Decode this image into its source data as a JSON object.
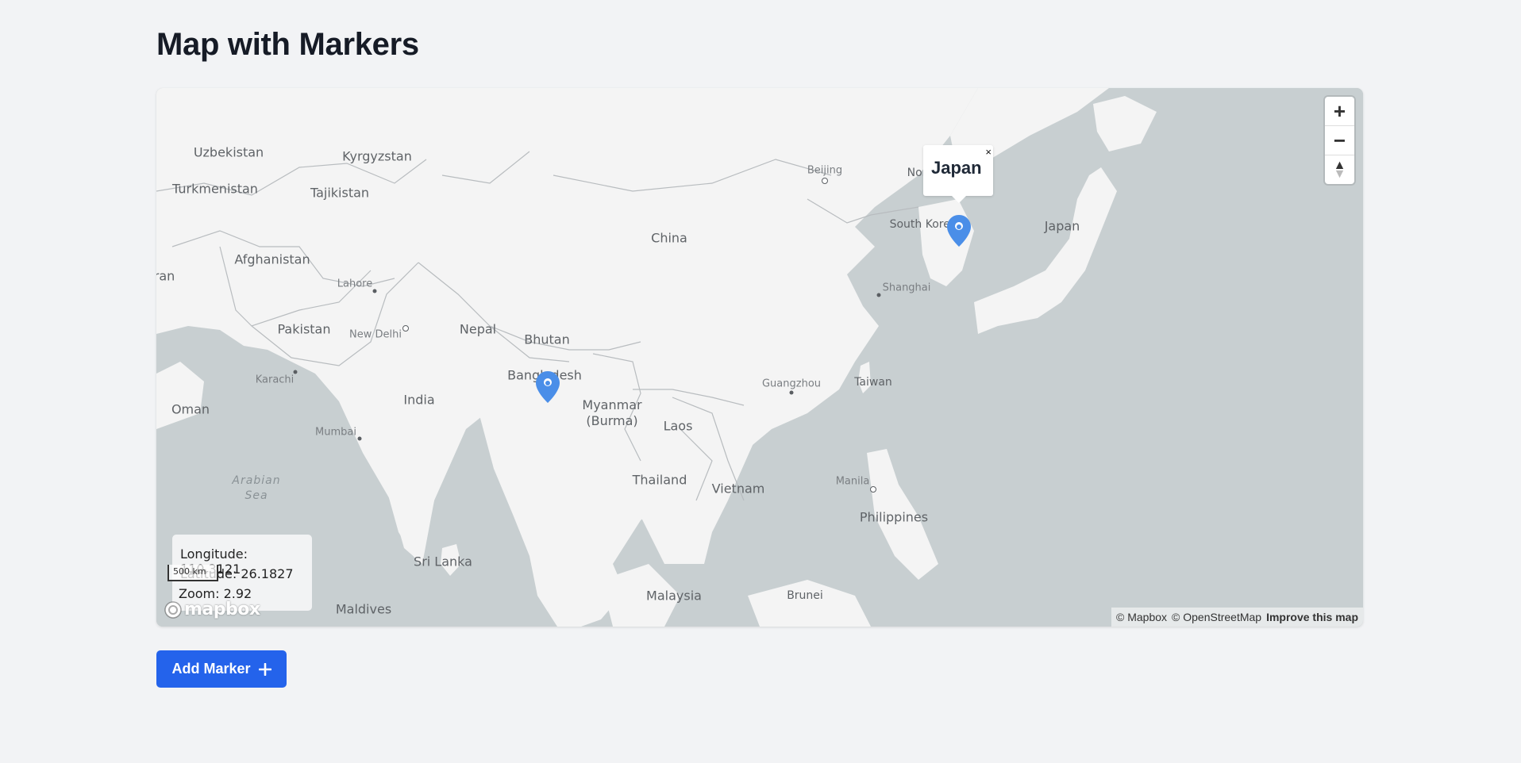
{
  "page": {
    "title": "Map with Markers"
  },
  "map": {
    "colors": {
      "water": "#c8cfd1",
      "land": "#f4f4f4",
      "border": "#b8bcbf",
      "marker": "#4a8ee8"
    },
    "countries": [
      "Uzbekistan",
      "Kyrgyzstan",
      "Turkmenistan",
      "Tajikistan",
      "Afghanistan",
      "ran",
      "Pakistan",
      "Nepal",
      "Bhutan",
      "China",
      "Bangladesh",
      "India",
      "Oman",
      "Myanmar (Burma)",
      "Laos",
      "Thailand",
      "Vietnam",
      "Philippines",
      "Sri Lanka",
      "Malaysia",
      "Brunei",
      "Maldives",
      "Taiwan",
      "Japan",
      "South Korea",
      "Nor"
    ],
    "cities": [
      "Beijing",
      "Lahore",
      "New Delhi",
      "Karachi",
      "Mumbai",
      "Shanghai",
      "Guangzhou",
      "Manila"
    ],
    "seas": [
      "Arabian Sea"
    ],
    "markers": [
      {
        "name": "marker-bangladesh",
        "icon": "map-pin-icon"
      },
      {
        "name": "marker-korea",
        "icon": "map-pin-icon"
      }
    ],
    "popup": {
      "title": "Japan",
      "close": "×"
    },
    "controls": {
      "zoom_in": "+",
      "zoom_out": "−",
      "compass": "▲"
    },
    "info": {
      "longitude_label": "Longitude:",
      "longitude": "110.3121",
      "latitude_label": "Latitude:",
      "latitude": "26.1827",
      "zoom_label": "Zoom:",
      "zoom": "2.92"
    },
    "scale": "500 km",
    "logo": "mapbox",
    "attribution": {
      "mapbox": "© Mapbox",
      "osm": "© OpenStreetMap",
      "improve": "Improve this map"
    }
  },
  "actions": {
    "add_marker_label": "Add Marker",
    "add_marker_icon": "plus-icon"
  }
}
